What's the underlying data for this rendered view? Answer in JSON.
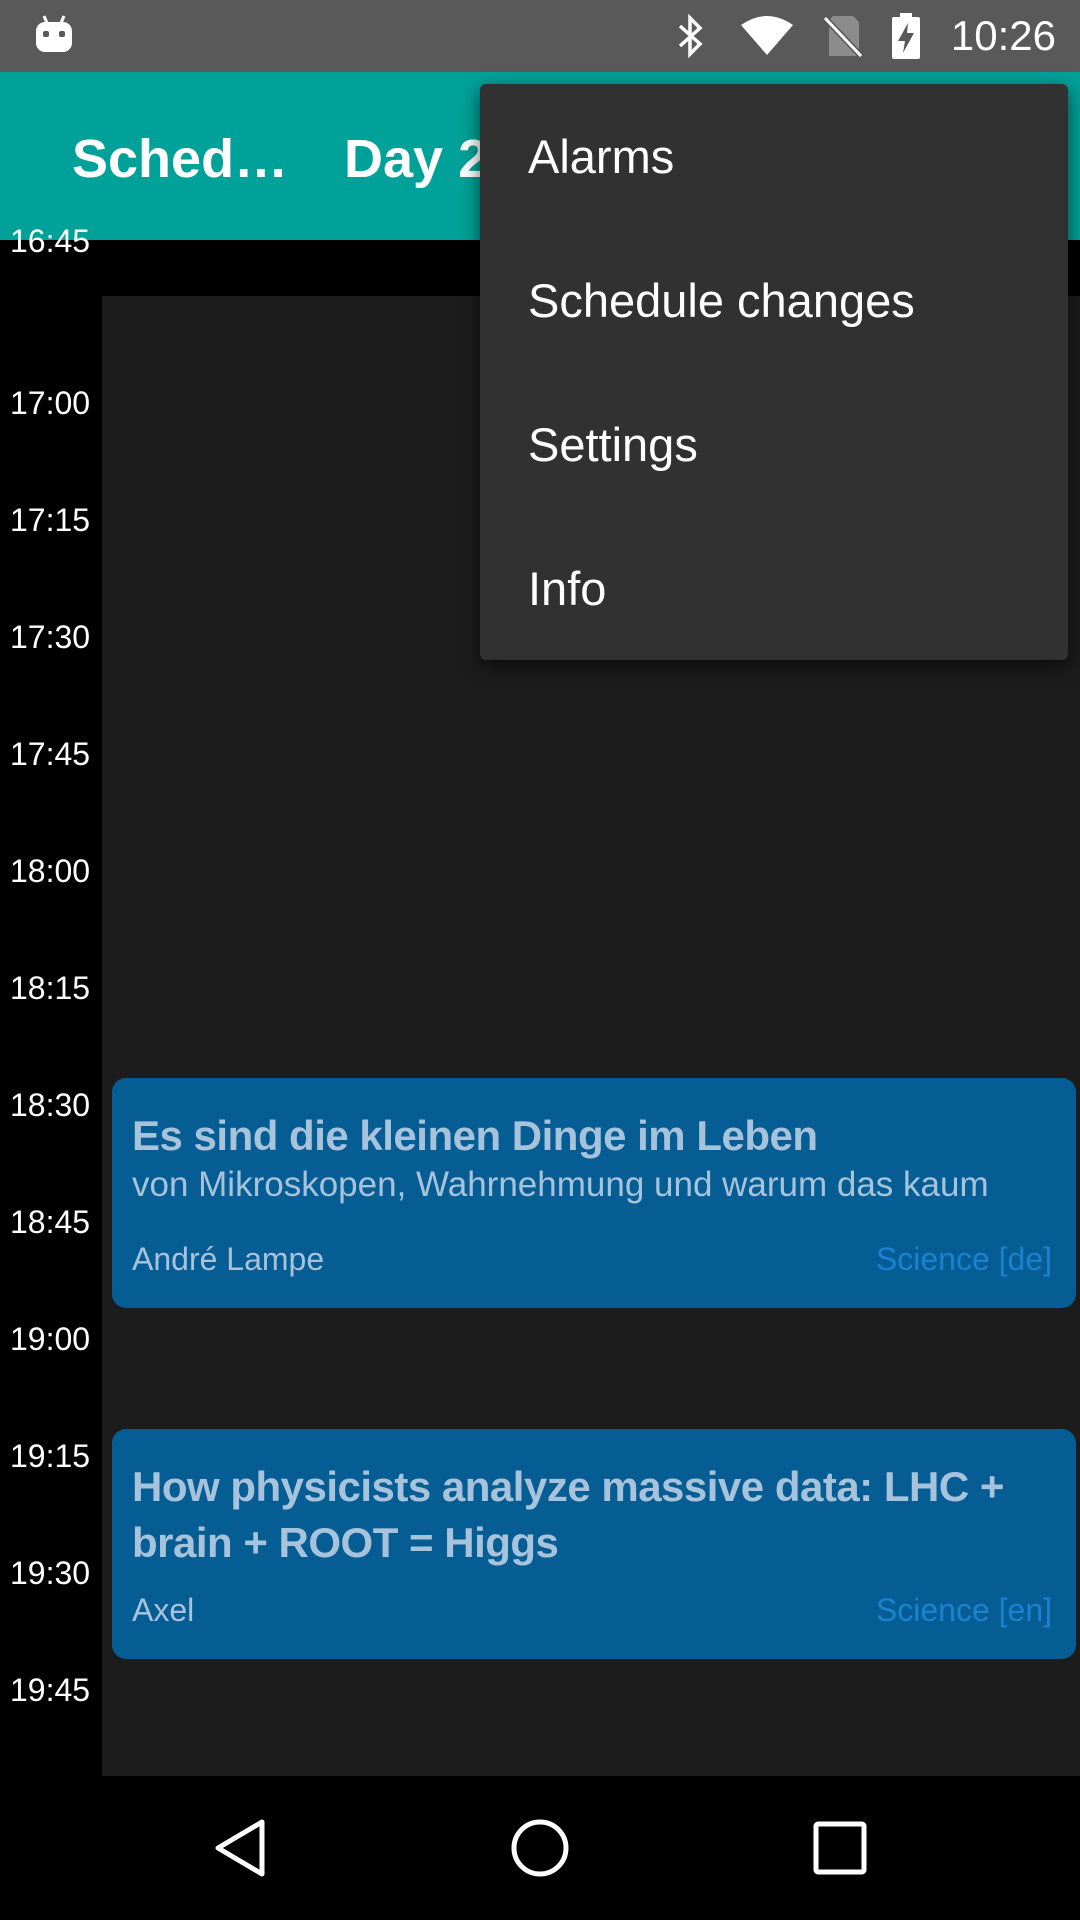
{
  "status_bar": {
    "time": "10:26",
    "icons": [
      "android-robot-icon",
      "bluetooth-icon",
      "wifi-icon",
      "no-sim-icon",
      "battery-charging-icon"
    ]
  },
  "app_bar": {
    "title": "Sched…",
    "day_label": "Day 2",
    "color": "#00a198"
  },
  "schedule": {
    "time_labels": [
      "16:45",
      "17:00",
      "17:15",
      "17:30",
      "17:45",
      "18:00",
      "18:15",
      "18:30",
      "18:45",
      "19:00",
      "19:15",
      "19:30",
      "19:45"
    ],
    "events": [
      {
        "title": "Es sind die kleinen Dinge im Leben",
        "subtitle": "von Mikroskopen, Wahrnehmung und warum das kaum jemanden interessiert",
        "speaker": "André Lampe",
        "track": "Science [de]"
      },
      {
        "title": "How physicists analyze massive data: LHC + brain + ROOT = Higgs",
        "subtitle": "",
        "speaker": "Axel",
        "track": "Science [en]"
      }
    ],
    "event_color": "#055d94"
  },
  "overflow_menu": {
    "items": [
      "Alarms",
      "Schedule changes",
      "Settings",
      "Info"
    ]
  },
  "nav_bar": {
    "buttons": [
      "back-icon",
      "home-icon",
      "recents-icon"
    ]
  }
}
